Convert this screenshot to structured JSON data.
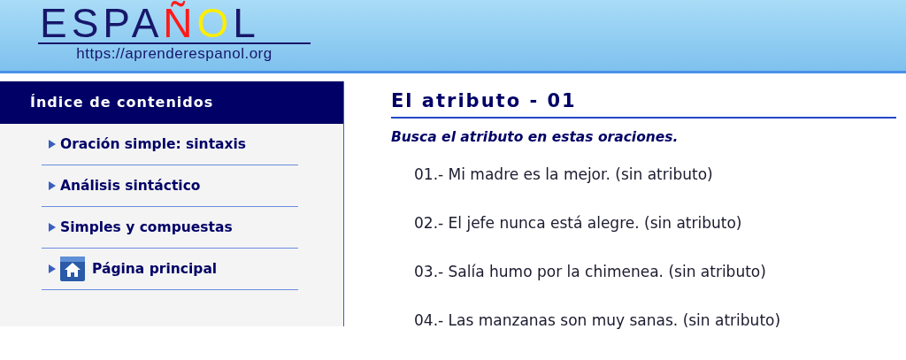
{
  "header": {
    "logo": [
      {
        "text": "ESPA",
        "color": "#17176b"
      },
      {
        "text": "Ñ",
        "color": "#ff1a1a"
      },
      {
        "text": "O",
        "color": "#ffee00"
      },
      {
        "text": "L",
        "color": "#17176b"
      }
    ],
    "url": "https://aprenderespanol.org"
  },
  "sidebar": {
    "title": "Índice de contenidos",
    "items": [
      {
        "label": "Oración simple: sintaxis",
        "kind": "link"
      },
      {
        "label": "Análisis sintáctico",
        "kind": "link"
      },
      {
        "label": "Simples y compuestas",
        "kind": "link"
      },
      {
        "label": "Página principal",
        "kind": "home"
      }
    ]
  },
  "main": {
    "title": "El atributo - 01",
    "instruction": "Busca el atributo en estas oraciones.",
    "sentences": [
      "01.- Mi madre es la mejor. (sin atributo)",
      "02.- El jefe nunca está alegre. (sin atributo)",
      "03.- Salía humo por la chimenea. (sin atributo)",
      "04.- Las manzanas son muy sanas. (sin atributo)"
    ]
  }
}
